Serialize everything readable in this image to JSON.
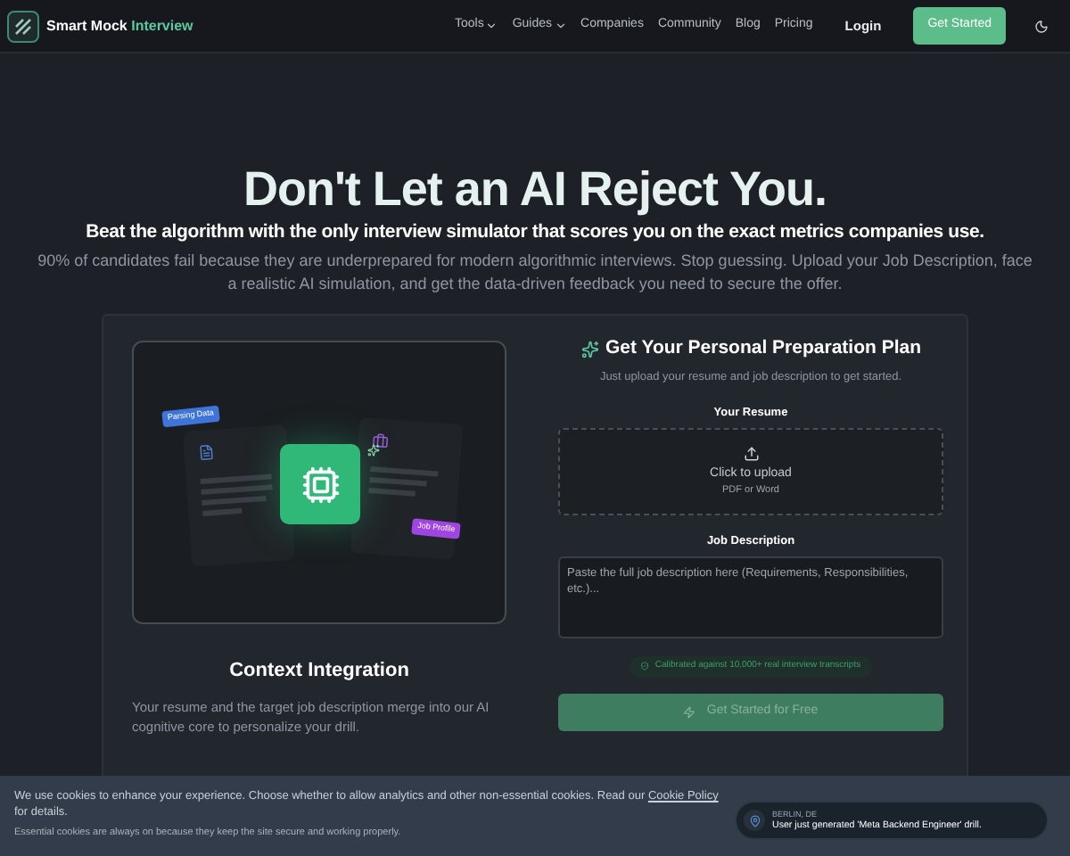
{
  "nav": {
    "brand_first": "Smart Mock",
    "brand_second": "Interview",
    "links": [
      {
        "label": "Tools",
        "dropdown": true
      },
      {
        "label": "Guides",
        "dropdown": true
      },
      {
        "label": "Companies",
        "dropdown": false
      },
      {
        "label": "Community",
        "dropdown": false
      },
      {
        "label": "Blog",
        "dropdown": false
      },
      {
        "label": "Pricing",
        "dropdown": false
      }
    ],
    "login": "Login",
    "cta": "Get Started"
  },
  "hero": {
    "title": "Don't Let an AI Reject You.",
    "subtitle": "Beat the algorithm with the only interview simulator that scores you on the exact metrics companies use.",
    "body": "90% of candidates fail because they are underprepared for modern algorithmic interviews. Stop guessing. Upload your Job Description, face a realistic AI simulation, and get the data-driven feedback you need to secure the offer."
  },
  "feature": {
    "tag_left": "Parsing Data",
    "tag_right": "Job Profile",
    "title": "Context Integration",
    "text": "Your resume and the target job description merge into our AI cognitive core to personalize your drill."
  },
  "form": {
    "title": "Get Your Personal Preparation Plan",
    "subtitle": "Just upload your resume and job description to get started.",
    "resume_label": "Your Resume",
    "upload_text": "Click to upload",
    "upload_hint": "PDF or Word",
    "jd_label": "Job Description",
    "jd_placeholder": "Paste the full job description here (Requirements, Responsibilities, etc.)...",
    "badge": "Calibrated against 10,000+ real interview transcripts",
    "submit": "Get Started for Free",
    "submit_disabled": true
  },
  "cookie": {
    "text_before": "We use cookies to enhance your experience. Choose whether to allow analytics and other non-essential cookies. Read our",
    "link": "Cookie Policy",
    "text_after": "for details.",
    "note": "Essential cookies are always on because they keep the site secure and working properly."
  },
  "toast": {
    "location": "BERLIN, DE",
    "message": "User just generated 'Meta Backend Engineer' drill."
  }
}
